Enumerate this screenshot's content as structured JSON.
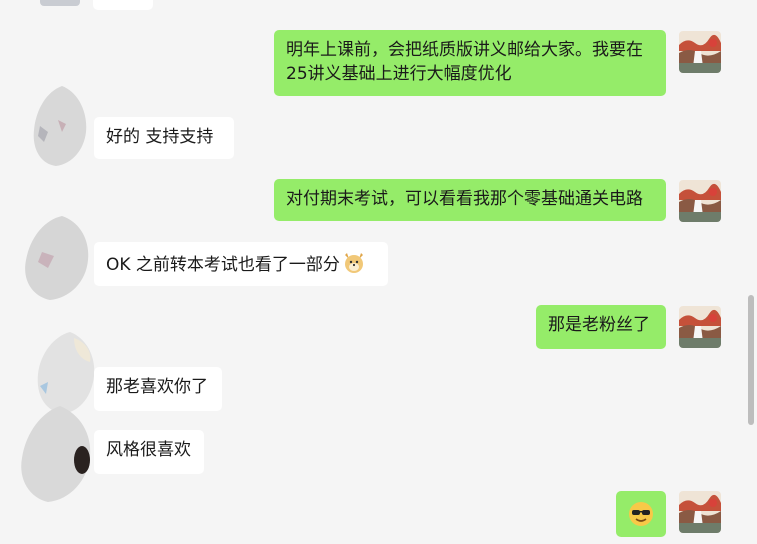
{
  "messages": [
    {
      "side": "out",
      "text": "明年上课前，会把纸质版讲义邮给大家。我要在",
      "text2": "25讲义基础上进行大幅度优化"
    },
    {
      "side": "in",
      "text": "好的  支持支持"
    },
    {
      "side": "out",
      "text": "对付期末考试，可以看看我那个零基础通关电路"
    },
    {
      "side": "in",
      "text": "OK  之前转本考试也看了一部分",
      "emoji": "dog-face-icon"
    },
    {
      "side": "out",
      "text": "那是老粉丝了"
    },
    {
      "side": "in",
      "text": "那老喜欢你了"
    },
    {
      "side": "in",
      "text": "风格很喜欢"
    },
    {
      "side": "out",
      "emoji": "sunglasses-smiley-icon"
    }
  ],
  "colors": {
    "outgoing_bubble": "#95ec69",
    "incoming_bubble": "#ffffff",
    "background": "#f5f5f5"
  }
}
